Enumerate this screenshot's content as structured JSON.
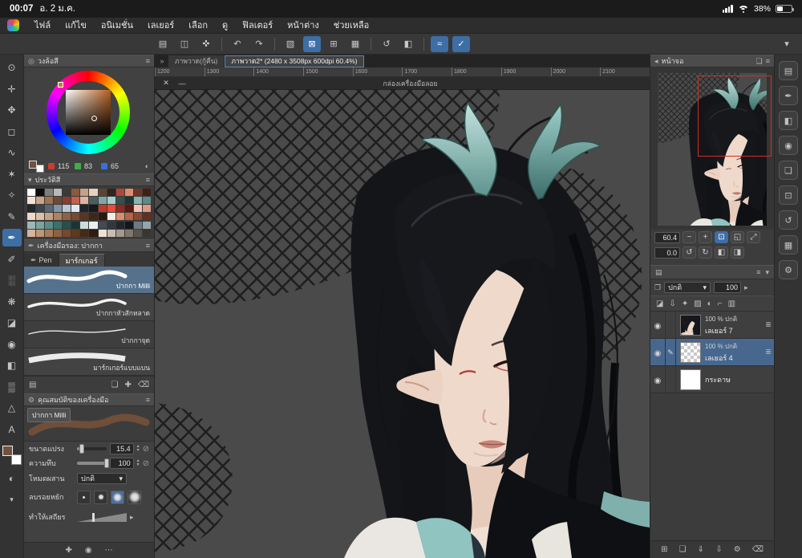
{
  "status_bar": {
    "time": "00:07",
    "date": "อ. 2 ม.ค.",
    "battery_percent": "38%"
  },
  "menu": {
    "items": [
      "ไฟล์",
      "แก้ไข",
      "อนิเมชั่น",
      "เลเยอร์",
      "เลือก",
      "ดู",
      "ฟิลเตอร์",
      "หน้าต่าง",
      "ช่วยเหลือ"
    ]
  },
  "toolbar": {
    "buttons": [
      {
        "n": "toolbox-toggle-icon",
        "g": "▤"
      },
      {
        "n": "quick-access-icon",
        "g": "◫"
      },
      {
        "n": "touch-gesture-icon",
        "g": "✜"
      },
      {
        "n": "toolbar-divider",
        "g": "",
        "c": "divider",
        "i": "false"
      },
      {
        "n": "undo-icon",
        "g": "↶"
      },
      {
        "n": "redo-icon",
        "g": "↷"
      },
      {
        "n": "toolbar-divider",
        "g": "",
        "c": "divider",
        "i": "false"
      },
      {
        "n": "deselect-icon",
        "g": "▧"
      },
      {
        "n": "snap-ruler-icon",
        "g": "⊠",
        "c": "active"
      },
      {
        "n": "snap-special-ruler-icon",
        "g": "⊞"
      },
      {
        "n": "snap-grid-icon",
        "g": "▦"
      },
      {
        "n": "toolbar-divider",
        "g": "",
        "c": "divider",
        "i": "false"
      },
      {
        "n": "rotate-canvas-icon",
        "g": "↺"
      },
      {
        "n": "flip-canvas-icon",
        "g": "◧"
      },
      {
        "n": "toolbar-divider",
        "g": "",
        "c": "divider",
        "i": "false"
      },
      {
        "n": "stabilization-icon",
        "g": "≈",
        "c": "active"
      },
      {
        "n": "vector-snap-icon",
        "g": "✓",
        "c": "active"
      },
      {
        "n": "toolbar-more-icon",
        "g": "▾"
      }
    ]
  },
  "tab_bar": {
    "scroll_icon": "»",
    "tabs": [
      {
        "label": "ภาพวาด(กู้คืน)",
        "c": ""
      },
      {
        "label": "ภาพวาด2* (2480 x 3508px 600dpi 60.4%)",
        "c": "active"
      }
    ]
  },
  "ruler": {
    "ticks": [
      "1200",
      "1300",
      "1400",
      "1500",
      "1600",
      "1700",
      "1800",
      "1900",
      "2000",
      "2100"
    ]
  },
  "canvas_window": {
    "title": "กล่องเครื่องมือลอย"
  },
  "left_tools": {
    "tools": [
      {
        "n": "zoom-tool",
        "g": "⊙"
      },
      {
        "n": "hand-tool",
        "g": "✛"
      },
      {
        "n": "move-tool",
        "g": "✥"
      },
      {
        "n": "selection-tool",
        "g": "◻"
      },
      {
        "n": "lasso-tool",
        "g": "∿"
      },
      {
        "n": "wand-tool",
        "g": "✶"
      },
      {
        "n": "eyedropper-tool",
        "g": "✧"
      },
      {
        "n": "pencil-tool",
        "g": "✎"
      },
      {
        "n": "pen-tool",
        "g": "✒",
        "c": "active"
      },
      {
        "n": "brush-tool",
        "g": "✐"
      },
      {
        "n": "airbrush-tool",
        "g": "░"
      },
      {
        "n": "decoration-tool",
        "g": "❋"
      },
      {
        "n": "eraser-tool",
        "g": "◪"
      },
      {
        "n": "blend-tool",
        "g": "◉"
      },
      {
        "n": "fill-tool",
        "g": "◧"
      },
      {
        "n": "gradient-tool",
        "g": "▒"
      },
      {
        "n": "figure-tool",
        "g": "△"
      },
      {
        "n": "text-tool",
        "g": "A"
      }
    ]
  },
  "color_wheel": {
    "title": "วงล้อสี",
    "r": "115",
    "g": "83",
    "b": "65",
    "selected_color": "#73513F"
  },
  "color_history": {
    "title": "ประวัติสี",
    "colors": [
      "#ffffff",
      "#0d0d0d",
      "#7d7d7d",
      "#b8b8b8",
      "#3a3a3a",
      "#8a5a3c",
      "#c7a183",
      "#e8d0bd",
      "#5d4430",
      "#2e2420",
      "#b0453a",
      "#d98f6e",
      "#70352a",
      "#411f18",
      "#f2e3d5",
      "#caa58a",
      "#9c7250",
      "#6b4a33",
      "#8c3b30",
      "#c75f4a",
      "#e0b4a0",
      "#4a5e62",
      "#7fa8a4",
      "#a9ccc8",
      "#31504e",
      "#1d3433",
      "#87b5b1",
      "#5d8a86",
      "#23272b",
      "#3c444c",
      "#596673",
      "#8395a5",
      "#b7c6d1",
      "#dfe7ec",
      "#20242a",
      "#16181c",
      "#c0392b",
      "#e74c3c",
      "#8e2a20",
      "#5a1812",
      "#f1c4b8",
      "#d99a88",
      "#ecd9c8",
      "#dcbfa8",
      "#c5a186",
      "#ad8265",
      "#8f6246",
      "#744a31",
      "#5a3622",
      "#412517",
      "#2b1810",
      "#f5ece3",
      "#dd8d6a",
      "#b56545",
      "#8a4730",
      "#62301e",
      "#9fb8b5",
      "#7da39f",
      "#5b8d88",
      "#3d6f6b",
      "#2a4f4c",
      "#1b3533",
      "#cddcda",
      "#e9f0ef",
      "#444b52",
      "#31373d",
      "#22262b",
      "#14171a",
      "#6e7a85",
      "#97a3ad",
      "#d4b59e",
      "#bf9678",
      "#a87a58",
      "#90603f",
      "#774a2c",
      "#5e381f",
      "#462a15",
      "#301c0e",
      "#efe2d2",
      "#c8beb4",
      "#a49a8f",
      "#7f776d",
      "#5a544c",
      "#3a352f"
    ]
  },
  "subtool": {
    "title": "เครื่องมือรอง: ปากกา",
    "tab_pen": "Pen",
    "tab_marker": "มาร์กเกอร์",
    "brushes": [
      {
        "name": "ปากกา Milli"
      },
      {
        "name": "ปากกาหัวสักหลาด"
      },
      {
        "name": "ปากกาจุด"
      },
      {
        "name": "มาร์กเกอร์แบบแบน"
      }
    ]
  },
  "tool_property": {
    "title": "คุณสมบัติของเครื่องมือ",
    "brush_name": "ปากกา Milli",
    "size_label": "ขนาดแปรง",
    "size_value": "15.4",
    "opacity_label": "ความทึบ",
    "opacity_value": "100",
    "blend_label": "โหมดผสาน",
    "blend_value": "ปกติ",
    "aa_label": "ลบรอยหยัก",
    "stab_label": "ทำให้เสถียร"
  },
  "navigator": {
    "title": "หน้าจอ",
    "zoom_value": "60.4",
    "rotate_value": "0.0"
  },
  "layer_panel": {
    "blend_mode": "ปกติ",
    "opacity_value": "100",
    "layers": [
      {
        "info": "100 % ปกติ",
        "name": "เลเยอร์ 7"
      },
      {
        "info": "100 % ปกติ",
        "name": "เลเยอร์ 4"
      },
      {
        "info": "",
        "name": "กระดาษ"
      }
    ]
  },
  "layer_icons": [
    {
      "n": "clip-to-layer-icon",
      "g": "◪"
    },
    {
      "n": "transfer-down-icon",
      "g": "⇩"
    },
    {
      "n": "lock-layer-icon",
      "g": "✦"
    },
    {
      "n": "lock-alpha-icon",
      "g": "▨"
    },
    {
      "n": "layer-mask-icon",
      "g": "◐"
    },
    {
      "n": "layer-ruler-icon",
      "g": "⌐"
    },
    {
      "n": "split-view-icon",
      "g": "▥"
    }
  ],
  "layer_bottom_icons": [
    {
      "n": "new-layer-icon",
      "g": "⊞"
    },
    {
      "n": "new-folder-icon",
      "g": "❏"
    },
    {
      "n": "merge-down-icon",
      "g": "⇓"
    },
    {
      "n": "transfer-icon",
      "g": "⇩"
    },
    {
      "n": "layer-settings-icon",
      "g": "⚙"
    },
    {
      "n": "delete-layer-icon",
      "g": "⌫"
    }
  ],
  "right_strip_icons": [
    {
      "n": "panel-toolbox-icon",
      "g": "▤"
    },
    {
      "n": "panel-subtool-icon",
      "g": "✒"
    },
    {
      "n": "panel-color-icon",
      "g": "◧"
    },
    {
      "n": "panel-brush-size-icon",
      "g": "◉"
    },
    {
      "n": "panel-layer-icon",
      "g": "❏"
    },
    {
      "n": "panel-navigator-icon",
      "g": "⊡"
    },
    {
      "n": "panel-history-icon",
      "g": "↺"
    },
    {
      "n": "panel-material-icon",
      "g": "▦"
    },
    {
      "n": "panel-settings-icon",
      "g": "⚙"
    }
  ],
  "lp_bottom_icons": [
    {
      "n": "register-color-icon",
      "g": "✚"
    },
    {
      "n": "mixer-icon",
      "g": "◉"
    },
    {
      "n": "panel-more-icon",
      "g": "⋯"
    }
  ],
  "icons": {
    "close": "✕",
    "minimize": "—",
    "chev_down": "▾",
    "chev_right": "▸",
    "chev_left": "◂",
    "menu": "≡",
    "grip": "≣",
    "pencil": "✎",
    "minus": "−",
    "plus": "+",
    "fit": "⊡",
    "fit_window": "◱",
    "expand": "⤢",
    "rot_ccw": "↺",
    "rot_cw": "↻",
    "flip_h": "◧",
    "flip_v": "◨",
    "step_up": "▴",
    "step_down": "▾",
    "circle_toggle": "⊘",
    "trash": "⌫",
    "duplicate": "❏",
    "add": "✚",
    "layer_stack": "▤",
    "blend_chip": "❐",
    "wheel": "◎",
    "gear": "⚙",
    "pen": "✒",
    "half_circle": "◐",
    "wave": "≋"
  }
}
